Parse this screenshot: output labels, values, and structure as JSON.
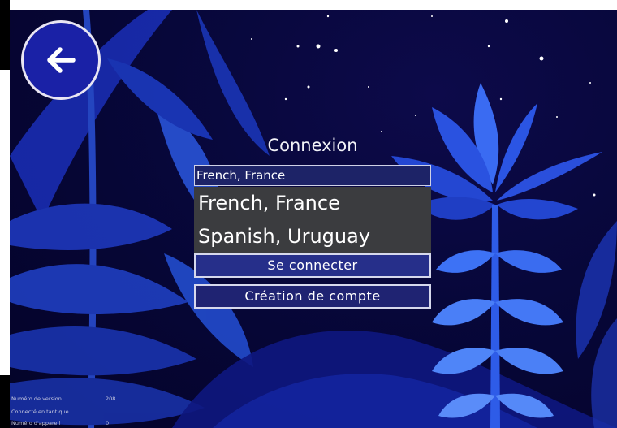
{
  "screen": {
    "title": "Connexion",
    "language_selected": "French, France",
    "language_options": [
      "French, France",
      "Spanish, Uruguay"
    ],
    "login_button": "Se connecter",
    "create_account_button": "Création de compte"
  },
  "info": {
    "version_label": "Numéro de version",
    "version_value": "208",
    "connected_as_label": "Connecté en tant que",
    "device_label": "Numéro d'appareil",
    "device_value": "0"
  },
  "icons": {
    "back": "arrow-left-icon"
  },
  "colors": {
    "background": "#07073a",
    "button": "#262f8a",
    "dropdown": "#3b3c3f",
    "back_circle": "#1a21a6"
  }
}
